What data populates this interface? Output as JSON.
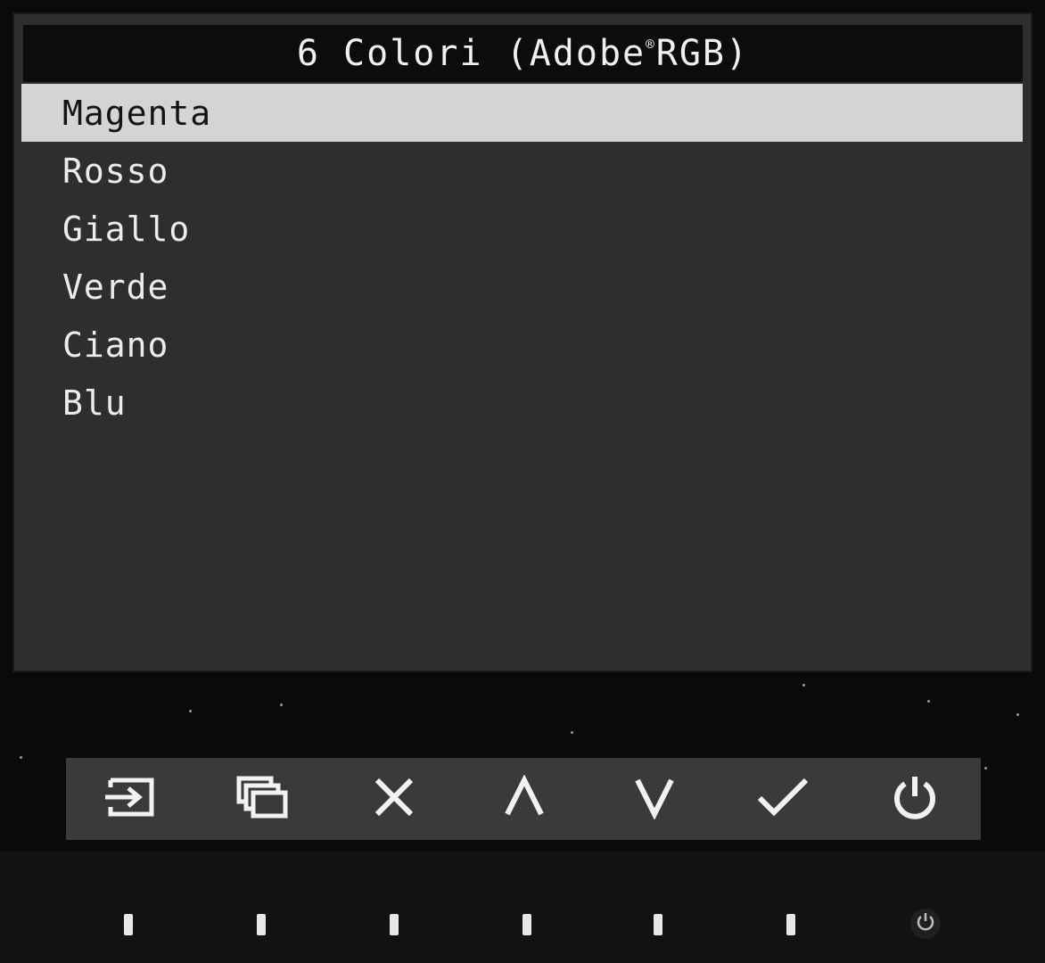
{
  "osd": {
    "title_main": "6 Colori (Adobe",
    "title_reg": "®",
    "title_tail": "RGB)",
    "items": [
      {
        "label": "Magenta",
        "selected": true
      },
      {
        "label": "Rosso",
        "selected": false
      },
      {
        "label": "Giallo",
        "selected": false
      },
      {
        "label": "Verde",
        "selected": false
      },
      {
        "label": "Ciano",
        "selected": false
      },
      {
        "label": "Blu",
        "selected": false
      }
    ]
  },
  "buttons": [
    {
      "icon": "input-switch-icon"
    },
    {
      "icon": "windows-icon"
    },
    {
      "icon": "close-icon"
    },
    {
      "icon": "up-arrow-icon"
    },
    {
      "icon": "down-arrow-icon"
    },
    {
      "icon": "checkmark-icon"
    },
    {
      "icon": "power-icon"
    }
  ],
  "colors": {
    "osd_background": "#2e2e2e",
    "title_background": "#0c0c0c",
    "selected_background": "#d4d4d4",
    "panel_background": "#3a3a3a"
  }
}
